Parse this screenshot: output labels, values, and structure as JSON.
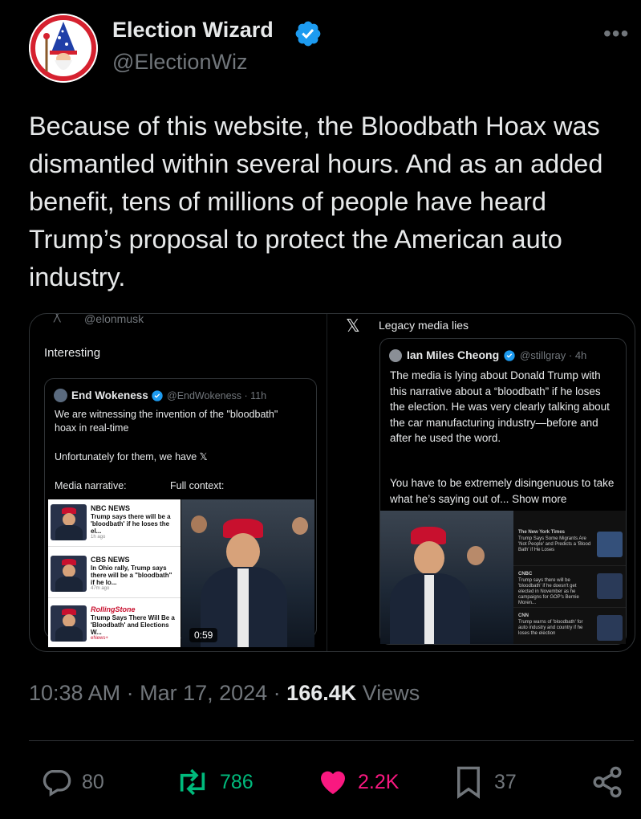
{
  "author": {
    "name": "Election Wizard",
    "handle": "@ElectionWiz",
    "verified": true,
    "avatar_icon": "wizard-avatar-icon"
  },
  "tweet": {
    "text": "Because of this website, the Bloodbath Hoax was dismantled within several hours. And as an added benefit, tens of millions of people have heard Trump’s proposal to protect the American auto industry."
  },
  "media": {
    "left": {
      "top_handle": "@elonmusk",
      "caption": "Interesting",
      "quoted": {
        "name": "End Wokeness",
        "handle_time": "@EndWokeness · 11h",
        "line1": "We are witnessing the invention of the \"bloodbath\" hoax in real-time",
        "line2": "Unfortunately for them, we have 𝕏",
        "col_left": "Media narrative:",
        "col_right": "Full context:"
      },
      "news": [
        {
          "source": "NBC NEWS",
          "headline": "Trump says there will be a 'bloodbath' if he loses the el...",
          "time": "1h ago"
        },
        {
          "source": "CBS NEWS",
          "headline": "In Ohio rally, Trump says there will be a \"bloodbath\" if he lo...",
          "time": "47m ago"
        },
        {
          "source": "RollingStone",
          "headline": "Trump Says There Will Be a 'Bloodbath' and Elections W...",
          "time": "eNews+"
        }
      ],
      "video_duration": "0:59"
    },
    "right": {
      "caption": "Legacy media lies",
      "quoted": {
        "name": "Ian Miles Cheong",
        "handle_time": "@stillgray · 4h",
        "line1": "The media is lying about Donald Trump with this narrative about a “bloodbath” if he loses the election. He was very clearly talking about the car manufacturing industry—before and after he used the word.",
        "line2": "You have to be extremely disingenuous to take what he’s saying out of... Show more"
      },
      "news": [
        {
          "source": "The New York Times",
          "headline": "Trump Says Some Migrants Are 'Not People' and Predicts a 'Blood Bath' if He Loses"
        },
        {
          "source": "CNBC",
          "headline": "Trump says there will be 'bloodbath' if he doesn't get elected in November as he campaigns for GOP's Bernie Moren..."
        },
        {
          "source": "CNN",
          "headline": "Trump warns of 'bloodbath' for auto industry and country if he loses the election"
        }
      ]
    }
  },
  "meta": {
    "time": "10:38 AM · Mar 17, 2024 · ",
    "views_count": "166.4K",
    "views_label": " Views"
  },
  "actions": {
    "replies": "80",
    "reposts": "786",
    "likes": "2.2K",
    "bookmarks": "37"
  },
  "colors": {
    "background": "#000000",
    "text": "#e7e9ea",
    "secondary": "#71767b",
    "verified": "#1d9bf0",
    "repost": "#00ba7c",
    "like": "#f91880"
  }
}
